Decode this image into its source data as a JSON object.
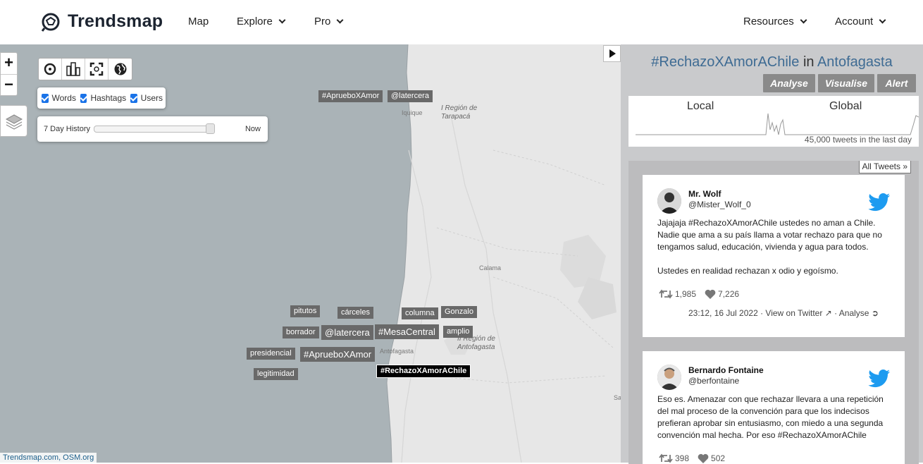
{
  "header": {
    "brand": "Trendsmap",
    "nav": {
      "map": "Map",
      "explore": "Explore",
      "pro": "Pro",
      "resources": "Resources",
      "account": "Account"
    }
  },
  "map": {
    "zoom_in": "+",
    "zoom_out": "−",
    "filters": {
      "words": "Words",
      "hashtags": "Hashtags",
      "users": "Users"
    },
    "history": {
      "label": "7 Day History",
      "now": "Now",
      "position": 0.98
    },
    "attribution": "Trendsmap.com, OSM.org",
    "places": {
      "tarapaca": "I Región de\nTarapacá",
      "iquique": "Iquique",
      "calama": "Calama",
      "antofagasta_region": "II Región de\nAntofagasta",
      "antofagasta": "Antofagasta",
      "edge": "Sa"
    },
    "tags": {
      "t1": "#AprueboXAmor",
      "t2": "@latercera",
      "t3": "pitutos",
      "t4": "cárceles",
      "t5": "columna",
      "t6": "Gonzalo",
      "t7": "borrador",
      "t8": "@latercera",
      "t9": "#MesaCentral",
      "t10": "amplio",
      "t11": "presidencial",
      "t12": "#AprueboXAmor",
      "t13": "legitimidad",
      "t14": "#RechazoXAmorAChile"
    }
  },
  "sidebar": {
    "hashtag": "#RechazoXAmorAChile",
    "in": "in",
    "location": "Antofagasta",
    "buttons": {
      "analyse": "Analyse",
      "visualise": "Visualise",
      "alert": "Alert"
    },
    "local_label": "Local",
    "global_label": "Global",
    "tweet_count": "45,000 tweets in the last day",
    "all_tweets": "All Tweets »"
  },
  "tweets": [
    {
      "name": "Mr. Wolf",
      "handle": "@Mister_Wolf_0",
      "text1": "Jajajaja #RechazoXAmorAChile ustedes no aman a Chile. Nadie que ama a su país llama a votar rechazo para que no tengamos salud, educación, vivienda y agua para todos.",
      "text2": "Ustedes en realidad rechazan x odio y egoísmo.",
      "retweets": "1,985",
      "likes": "7,226",
      "time": "23:12, 16 Jul 2022",
      "view": "View on Twitter",
      "analyse": "Analyse"
    },
    {
      "name": "Bernardo Fontaine",
      "handle": "@berfontaine",
      "text1": "Eso es. Amenazar con que rechazar llevara a una repetición del mal proceso de la convención para que los indecisos prefieran aprobar sin entusiasmo, con miedo a una segunda convención mal hecha. Por eso #RechazoXAmorAChile",
      "retweets": "398",
      "likes": "502"
    }
  ],
  "colors": {
    "map_water": "#aab3b7",
    "map_land": "#e7e7e7",
    "sidebar": "#c9cacc",
    "link": "#3e6b93",
    "twitter": "#1d9bf0"
  }
}
